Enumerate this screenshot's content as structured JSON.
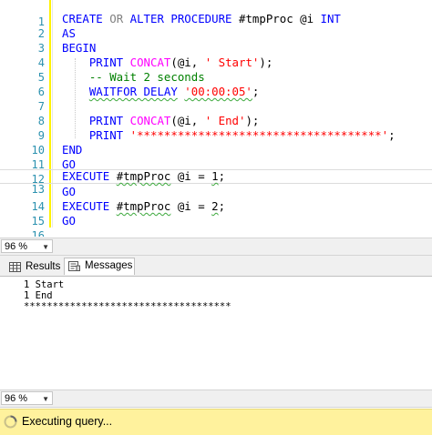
{
  "editor": {
    "lines": [
      {
        "n": "1",
        "text": ""
      },
      {
        "n": "2",
        "text": "CREATE OR ALTER PROCEDURE #tmpProc @i INT"
      },
      {
        "n": "3",
        "text": "AS"
      },
      {
        "n": "4",
        "text": "BEGIN"
      },
      {
        "n": "5",
        "text": "    PRINT CONCAT(@i, ' Start');"
      },
      {
        "n": "6",
        "text": "    -- Wait 2 seconds"
      },
      {
        "n": "7",
        "text": "    WAITFOR DELAY '00:00:05';"
      },
      {
        "n": "8",
        "text": ""
      },
      {
        "n": "9",
        "text": "    PRINT CONCAT(@i, ' End');"
      },
      {
        "n": "10",
        "text": "    PRINT '************************************';"
      },
      {
        "n": "11",
        "text": "END"
      },
      {
        "n": "12",
        "text": "GO"
      },
      {
        "n": "13",
        "text": "EXECUTE #tmpProc @i = 1;"
      },
      {
        "n": "14",
        "text": "GO"
      },
      {
        "n": "15",
        "text": "EXECUTE #tmpProc @i = 2;"
      },
      {
        "n": "16",
        "text": "GO"
      }
    ]
  },
  "editor_zoom": "96 %",
  "results_zoom": "96 %",
  "tabs": {
    "results": "Results",
    "messages": "Messages"
  },
  "messages": [
    "1 Start",
    "1 End",
    "************************************"
  ],
  "status": {
    "text": "Executing query...",
    "color": "#fff29d"
  },
  "colors": {
    "keyword": "#0000ff",
    "function": "#ff00ff",
    "string": "#ff0000",
    "comment": "#008000",
    "line_number": "#2b91af"
  }
}
